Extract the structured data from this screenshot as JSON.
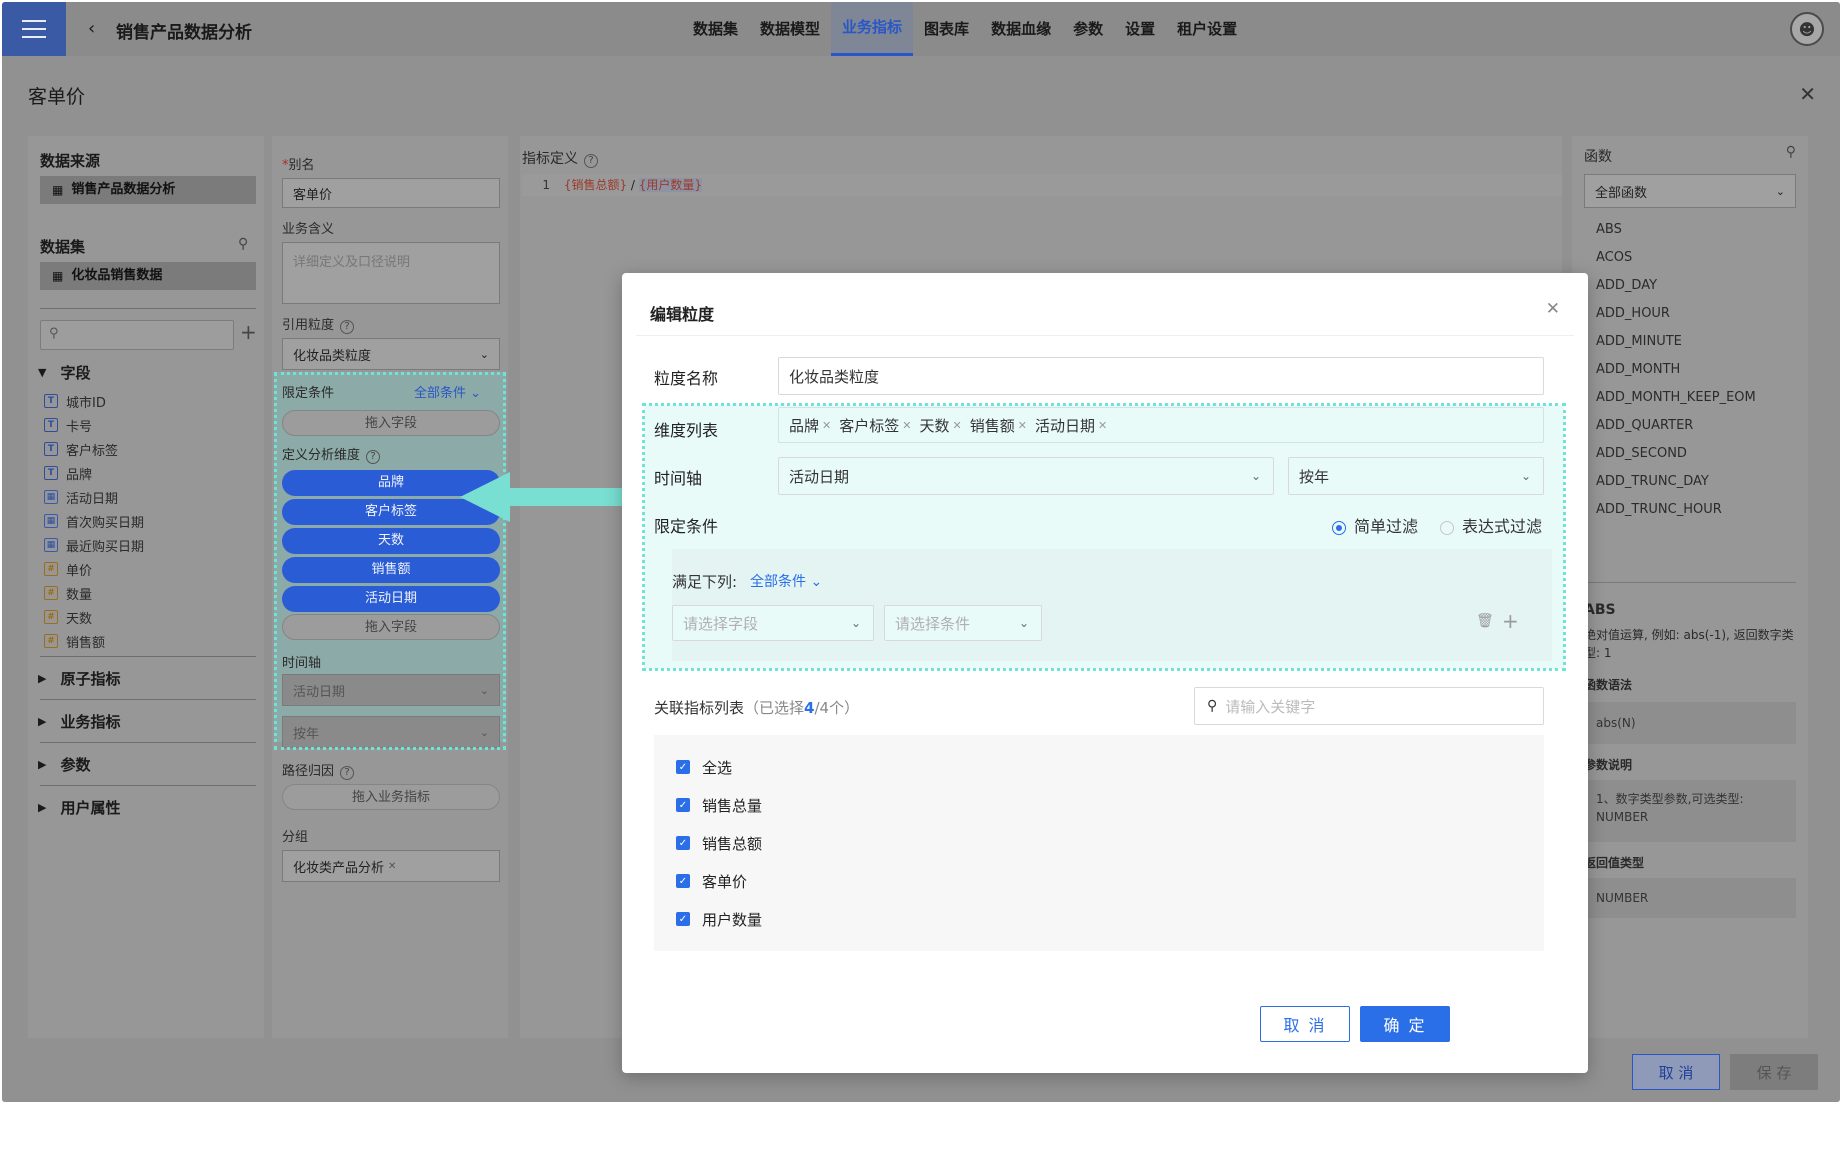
{
  "topbar": {
    "title": "销售产品数据分析",
    "nav": [
      "数据集",
      "数据模型",
      "业务指标",
      "图表库",
      "数据血缘",
      "参数",
      "设置",
      "租户设置"
    ],
    "active_index": 2
  },
  "drawer": {
    "title": "客单价",
    "cancel_label": "取 消",
    "save_label": "保 存"
  },
  "left": {
    "datasource_title": "数据来源",
    "datasource_value": "销售产品数据分析",
    "dataset_title": "数据集",
    "dataset_value": "化妆品销售数据",
    "fields_group": "字段",
    "fields": [
      {
        "name": "城市ID",
        "type": "T"
      },
      {
        "name": "卡号",
        "type": "T"
      },
      {
        "name": "客户标签",
        "type": "T"
      },
      {
        "name": "品牌",
        "type": "T"
      },
      {
        "name": "活动日期",
        "type": "date"
      },
      {
        "name": "首次购买日期",
        "type": "date"
      },
      {
        "name": "最近购买日期",
        "type": "date"
      },
      {
        "name": "单价",
        "type": "num"
      },
      {
        "name": "数量",
        "type": "num"
      },
      {
        "name": "天数",
        "type": "num"
      },
      {
        "name": "销售额",
        "type": "num"
      }
    ],
    "groups": [
      "原子指标",
      "业务指标",
      "参数",
      "用户属性"
    ]
  },
  "form": {
    "alias_label": "别名",
    "alias_value": "客单价",
    "meaning_label": "业务含义",
    "meaning_placeholder": "详细定义及口径说明",
    "granularity_label": "引用粒度",
    "granularity_value": "化妆品类粒度",
    "condition_label": "限定条件",
    "condition_link": "全部条件",
    "drag_field": "拖入字段",
    "dimension_label": "定义分析维度",
    "dimensions": [
      "品牌",
      "客户标签",
      "天数",
      "销售额",
      "活动日期"
    ],
    "time_axis_label": "时间轴",
    "time_axis_value": "活动日期",
    "time_unit_value": "按年",
    "path_label": "路径归因",
    "path_drag": "拖入业务指标",
    "group_label": "分组",
    "group_value": "化妆类产品分析"
  },
  "expr": {
    "label": "指标定义",
    "line_no": "1",
    "token_a": "{销售总额}",
    "op": " / ",
    "token_b": "{用户数量}"
  },
  "functions": {
    "title": "函数",
    "select_value": "全部函数",
    "items": [
      "ABS",
      "ACOS",
      "ADD_DAY",
      "ADD_HOUR",
      "ADD_MINUTE",
      "ADD_MONTH",
      "ADD_MONTH_KEEP_EOM",
      "ADD_QUARTER",
      "ADD_SECOND",
      "ADD_TRUNC_DAY",
      "ADD_TRUNC_HOUR"
    ],
    "detail_name": "ABS",
    "detail_desc": "绝对值运算, 例如: abs(-1), 返回数字类型: 1",
    "syntax_title": "函数语法",
    "syntax_value": "abs(N)",
    "param_title": "参数说明",
    "param_value": "1、数字类型参数,可选类型: NUMBER",
    "return_title": "返回值类型",
    "return_value": "NUMBER"
  },
  "modal": {
    "title": "编辑粒度",
    "name_label": "粒度名称",
    "name_value": "化妆品类粒度",
    "dims_label": "维度列表",
    "dims": [
      "品牌",
      "客户标签",
      "天数",
      "销售额",
      "活动日期"
    ],
    "time_label": "时间轴",
    "time_value": "活动日期",
    "time_unit": "按年",
    "cond_label": "限定条件",
    "radio_simple": "简单过滤",
    "radio_expr": "表达式过滤",
    "satisfy_label": "满足下列:",
    "satisfy_link": "全部条件",
    "select_field_ph": "请选择字段",
    "select_cond_ph": "请选择条件",
    "related_label": "关联指标列表",
    "related_prefix": "（已选择",
    "related_selected": "4",
    "related_suffix": "/4个）",
    "keyword_ph": "请输入关键字",
    "checks": [
      "全选",
      "销售总量",
      "销售总额",
      "客单价",
      "用户数量"
    ],
    "cancel_label": "取 消",
    "ok_label": "确 定"
  },
  "colors": {
    "primary": "#2a6ee8",
    "highlight": "#6ee4d6",
    "overlay": "#8b8b8b"
  }
}
